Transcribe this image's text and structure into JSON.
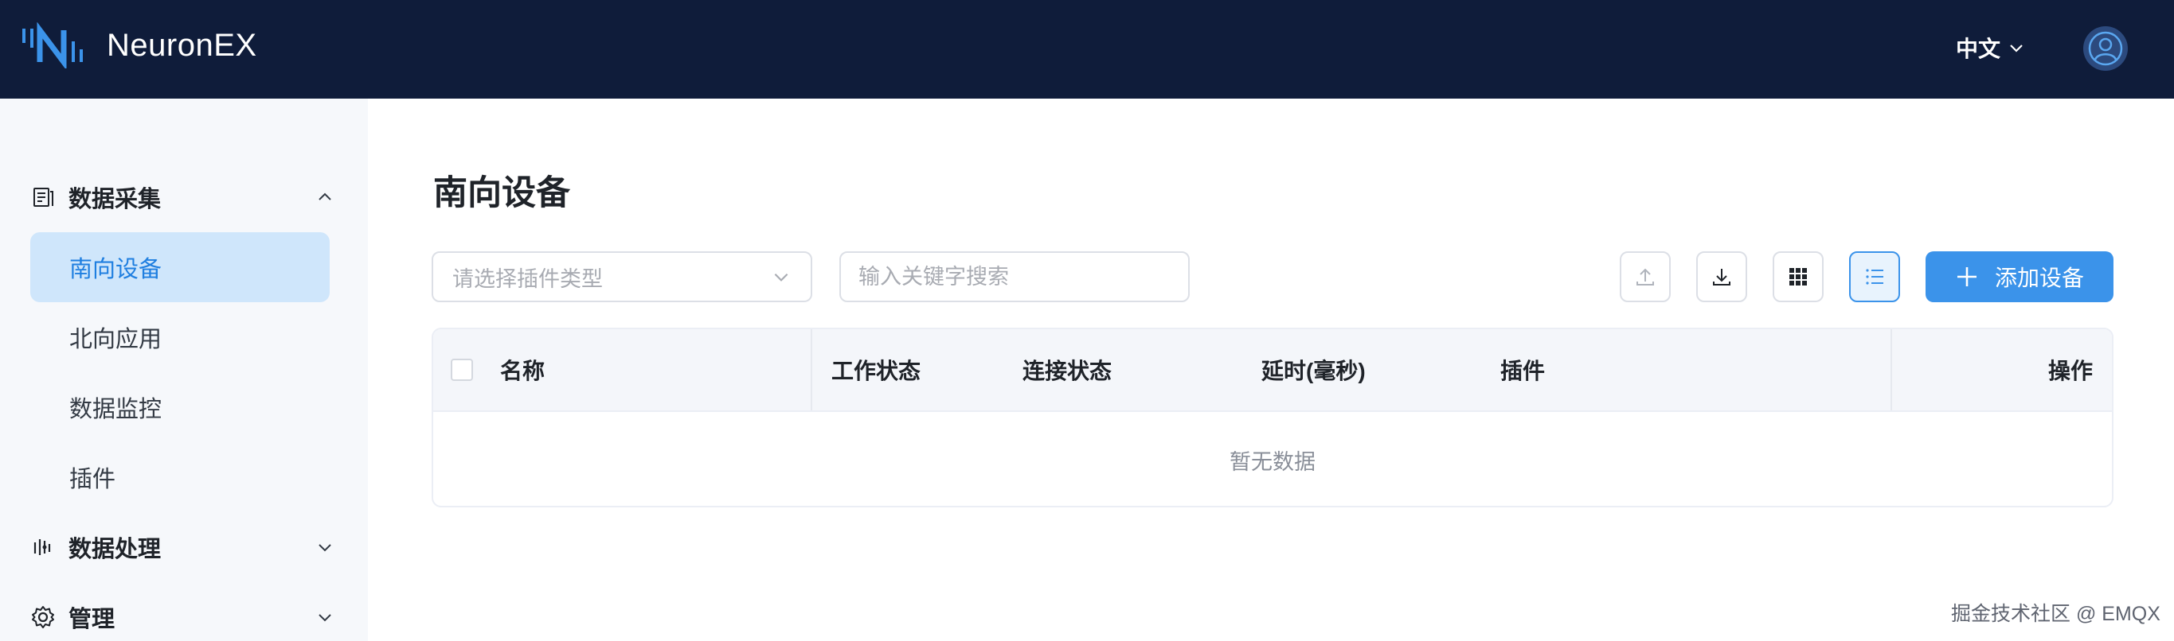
{
  "header": {
    "logo_text": "NeuronEX",
    "language": "中文"
  },
  "sidebar": {
    "groups": [
      {
        "label": "数据采集",
        "icon": "data-collection-icon",
        "expanded": true,
        "items": [
          {
            "label": "南向设备",
            "active": true
          },
          {
            "label": "北向应用",
            "active": false
          },
          {
            "label": "数据监控",
            "active": false
          },
          {
            "label": "插件",
            "active": false
          }
        ]
      },
      {
        "label": "数据处理",
        "icon": "data-processing-icon",
        "expanded": false
      },
      {
        "label": "管理",
        "icon": "gear-icon",
        "expanded": false
      }
    ]
  },
  "main": {
    "title": "南向设备",
    "plugin_select_placeholder": "请选择插件类型",
    "search_placeholder": "输入关键字搜索",
    "add_button_label": "添加设备",
    "view_mode": "list",
    "table": {
      "columns": [
        "名称",
        "工作状态",
        "连接状态",
        "延时(毫秒)",
        "插件",
        "操作"
      ],
      "rows": [],
      "empty_text": "暂无数据"
    }
  },
  "watermark": "掘金技术社区 @ EMQX",
  "colors": {
    "header_bg": "#0f1c3a",
    "accent": "#3b93ea",
    "active_item_bg": "#cfe6fb",
    "sidebar_bg": "#f6f8fb"
  }
}
